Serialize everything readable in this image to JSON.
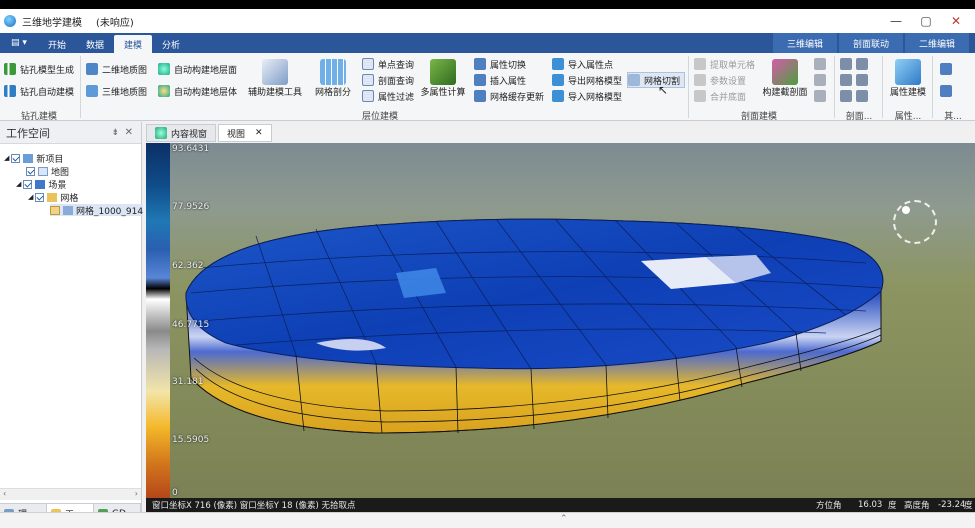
{
  "window": {
    "title": "三维地学建模",
    "status": "(未响应)"
  },
  "menu": {
    "quick_icon": "layout-icon",
    "tabs": [
      "开始",
      "数据",
      "建模",
      "分析"
    ],
    "active_tab": "建模",
    "context_tabs": [
      "三维编辑",
      "剖面联动",
      "二维编辑"
    ]
  },
  "ribbon": {
    "groups": [
      "钻孔建模",
      "层位建模",
      "剖面建模",
      "剖面...",
      "属性...",
      "其..."
    ],
    "drill": [
      "钻孔模型生成",
      "钻孔自动建模"
    ],
    "map": [
      "二维地质图",
      "三维地质图"
    ],
    "build": [
      "自动构建地层面",
      "自动构建地层体"
    ],
    "tool_big": "辅助建模工具",
    "mesh_big": "网格剖分",
    "query": [
      "单点查询",
      "剖面查询",
      "属性过滤"
    ],
    "multi_attr": "多属性计算",
    "attr": [
      "属性切换",
      "插入属性",
      "网格缓存更新"
    ],
    "io": [
      "导入属性点",
      "导出网格模型",
      "导入网格模型"
    ],
    "dragging": "网格切割",
    "section": [
      "提取单元格",
      "参数设置",
      "合并底面"
    ],
    "section_big": "构建截剖面",
    "attr_big": "属性建模"
  },
  "workspace": {
    "title": "工作空间",
    "pin": "⇟",
    "close": "✕",
    "tree": [
      "新项目",
      "地图",
      "场景",
      "网格",
      "网格_1000_914"
    ],
    "bottom_tabs": [
      "理...",
      "工...",
      "GD..."
    ]
  },
  "views": {
    "tabs": [
      "内容视窗",
      "视图"
    ],
    "active": "视图",
    "close": "✕"
  },
  "legend": {
    "values": [
      "93.6431",
      "77.9526",
      "62.362",
      "46.7715",
      "31.181",
      "15.5905",
      "0"
    ]
  },
  "status": {
    "coords": "窗口坐标X 716 (像素) 窗口坐标Y 18 (像素) 无拾取点",
    "azimuth_label": "方位角",
    "azimuth": "16.03",
    "unit1": "度",
    "elev_label": "高度角",
    "elev": "-23.24",
    "unit2": "度"
  }
}
